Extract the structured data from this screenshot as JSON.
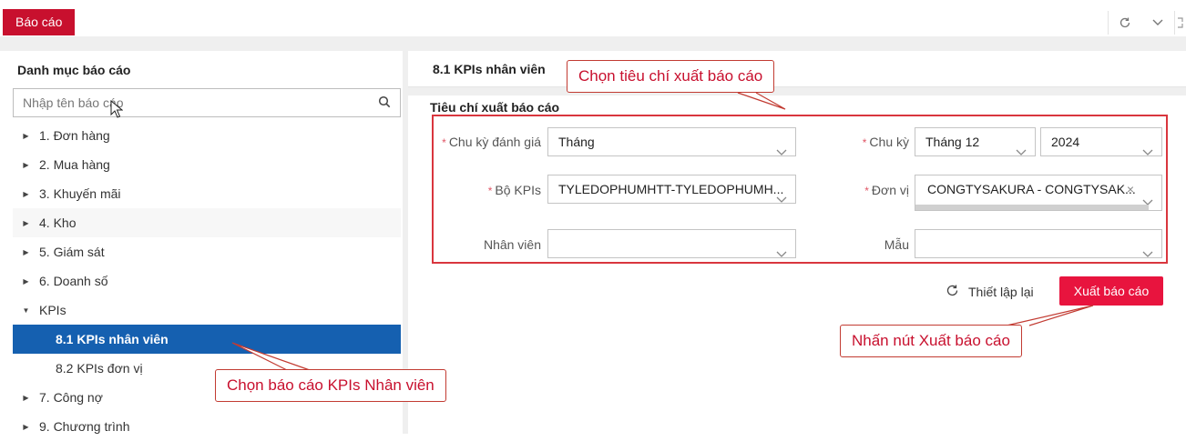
{
  "header": {
    "report_tab": "Báo cáo",
    "icons": [
      "refresh-icon",
      "chevron-down-icon",
      "expand-icon"
    ]
  },
  "sidebar": {
    "title": "Danh mục báo cáo",
    "search_placeholder": "Nhập tên báo cáo",
    "items": [
      {
        "label": "1. Đơn hàng"
      },
      {
        "label": "2. Mua hàng"
      },
      {
        "label": "3. Khuyến mãi"
      },
      {
        "label": "4. Kho"
      },
      {
        "label": "5. Giám sát"
      },
      {
        "label": "6. Doanh số"
      },
      {
        "label": "KPIs"
      },
      {
        "label": "8.1 KPIs nhân viên"
      },
      {
        "label": "8.2 KPIs đơn vị"
      },
      {
        "label": "7. Công nợ"
      },
      {
        "label": "9. Chương trình"
      }
    ]
  },
  "main": {
    "title": "8.1 KPIs nhân viên",
    "criteria_title": "Tiêu chí xuất báo cáo",
    "fields": {
      "cycle_eval_label": "Chu kỳ đánh giá",
      "cycle_eval_value": "Tháng",
      "cycle_label": "Chu kỳ",
      "cycle_month_value": "Tháng 12",
      "cycle_year_value": "2024",
      "kpi_set_label": "Bộ KPIs",
      "kpi_set_value": "TYLEDOPHUMHTT-TYLEDOPHUMH...",
      "unit_label": "Đơn vị",
      "unit_value": "CONGTYSAKURA - CONGTYSAK...",
      "employee_label": "Nhân viên",
      "employee_value": "",
      "template_label": "Mẫu",
      "template_value": ""
    },
    "reset_label": "Thiết lập lại",
    "export_label": "Xuất báo cáo"
  },
  "callouts": {
    "criteria": "Chọn tiêu chí xuất báo cáo",
    "select_report": "Chọn báo cáo KPIs Nhân viên",
    "export": "Nhấn nút Xuất báo cáo"
  },
  "colors": {
    "brand_red": "#c8102e",
    "export_button": "#e8143e",
    "selected_blue": "#1560b0",
    "annotation_red": "#d9363e"
  }
}
